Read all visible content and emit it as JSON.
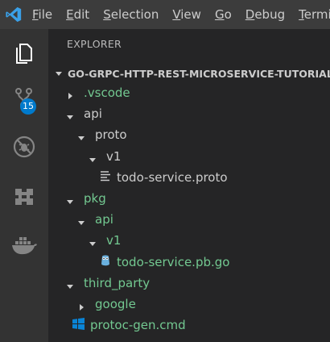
{
  "menu": {
    "items": [
      {
        "mnemonic": "F",
        "rest": "ile"
      },
      {
        "mnemonic": "E",
        "rest": "dit"
      },
      {
        "mnemonic": "S",
        "rest": "election"
      },
      {
        "mnemonic": "V",
        "rest": "iew"
      },
      {
        "mnemonic": "G",
        "rest": "o"
      },
      {
        "mnemonic": "D",
        "rest": "ebug"
      },
      {
        "mnemonic": "T",
        "rest": "ermi"
      }
    ]
  },
  "activity": {
    "scm_badge": "15"
  },
  "sidebar": {
    "title": "EXPLORER",
    "section": "GO-GRPC-HTTP-REST-MICROSERVICE-TUTORIAL"
  },
  "tree": [
    {
      "label": ".vscode",
      "kind": "folder",
      "expanded": false,
      "depth": 0,
      "color": "green"
    },
    {
      "label": "api",
      "kind": "folder",
      "expanded": true,
      "depth": 0,
      "color": "normal"
    },
    {
      "label": "proto",
      "kind": "folder",
      "expanded": true,
      "depth": 1,
      "color": "normal"
    },
    {
      "label": "v1",
      "kind": "folder",
      "expanded": true,
      "depth": 2,
      "color": "normal"
    },
    {
      "label": "todo-service.proto",
      "kind": "file",
      "icon": "text-lines-icon",
      "depth": 3,
      "color": "normal"
    },
    {
      "label": "pkg",
      "kind": "folder",
      "expanded": true,
      "depth": 0,
      "color": "green"
    },
    {
      "label": "api",
      "kind": "folder",
      "expanded": true,
      "depth": 1,
      "color": "green"
    },
    {
      "label": "v1",
      "kind": "folder",
      "expanded": true,
      "depth": 2,
      "color": "green"
    },
    {
      "label": "todo-service.pb.go",
      "kind": "file",
      "icon": "go-gopher-icon",
      "depth": 3,
      "color": "green"
    },
    {
      "label": "third_party",
      "kind": "folder",
      "expanded": true,
      "depth": 0,
      "color": "green"
    },
    {
      "label": "google",
      "kind": "folder",
      "expanded": false,
      "depth": 1,
      "color": "green"
    },
    {
      "label": "protoc-gen.cmd",
      "kind": "file",
      "icon": "windows-icon",
      "depth": 0,
      "color": "green"
    }
  ],
  "colors": {
    "accent": "#007acc",
    "git_untracked": "#73c991",
    "activitybar": "#333333",
    "sidebar": "#252526",
    "titlebar": "#3c3c3c"
  }
}
